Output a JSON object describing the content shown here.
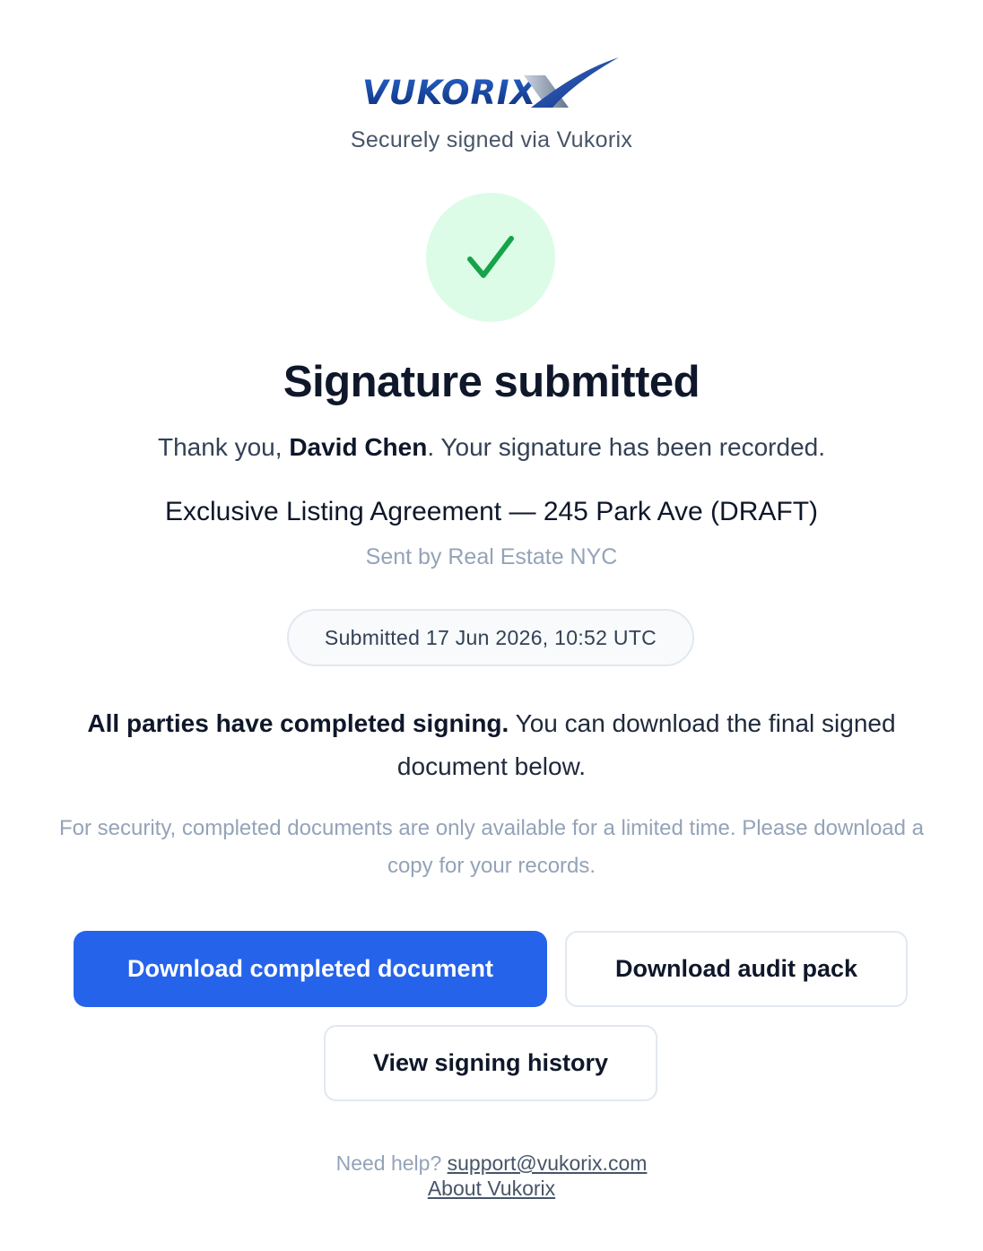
{
  "brand": {
    "logo_text": "VUKORIX",
    "tagline": "Securely signed via Vukorix"
  },
  "status": {
    "icon": "check-icon",
    "title": "Signature submitted",
    "thanks_prefix": "Thank you, ",
    "signer_name": "David Chen",
    "thanks_suffix": ". Your signature has been recorded."
  },
  "document": {
    "title": "Exclusive Listing Agreement — 245 Park Ave (DRAFT)",
    "sent_by": "Sent by Real Estate NYC",
    "submitted": "Submitted 17 Jun 2026, 10:52 UTC"
  },
  "completion": {
    "bold": "All parties have completed signing.",
    "rest": " You can download the final signed document below.",
    "security_note": "For security, completed documents are only available for a limited time. Please download a copy for your records."
  },
  "actions": {
    "download_completed": "Download completed document",
    "download_audit": "Download audit pack",
    "view_history": "View signing history"
  },
  "footer": {
    "help_prefix": "Need help? ",
    "support_email": "support@vukorix.com",
    "about_link": "About Vukorix"
  },
  "colors": {
    "primary": "#2563eb",
    "success_bg": "#dcfce7",
    "success": "#16a34a",
    "brand_blue": "#1e3a8a"
  }
}
